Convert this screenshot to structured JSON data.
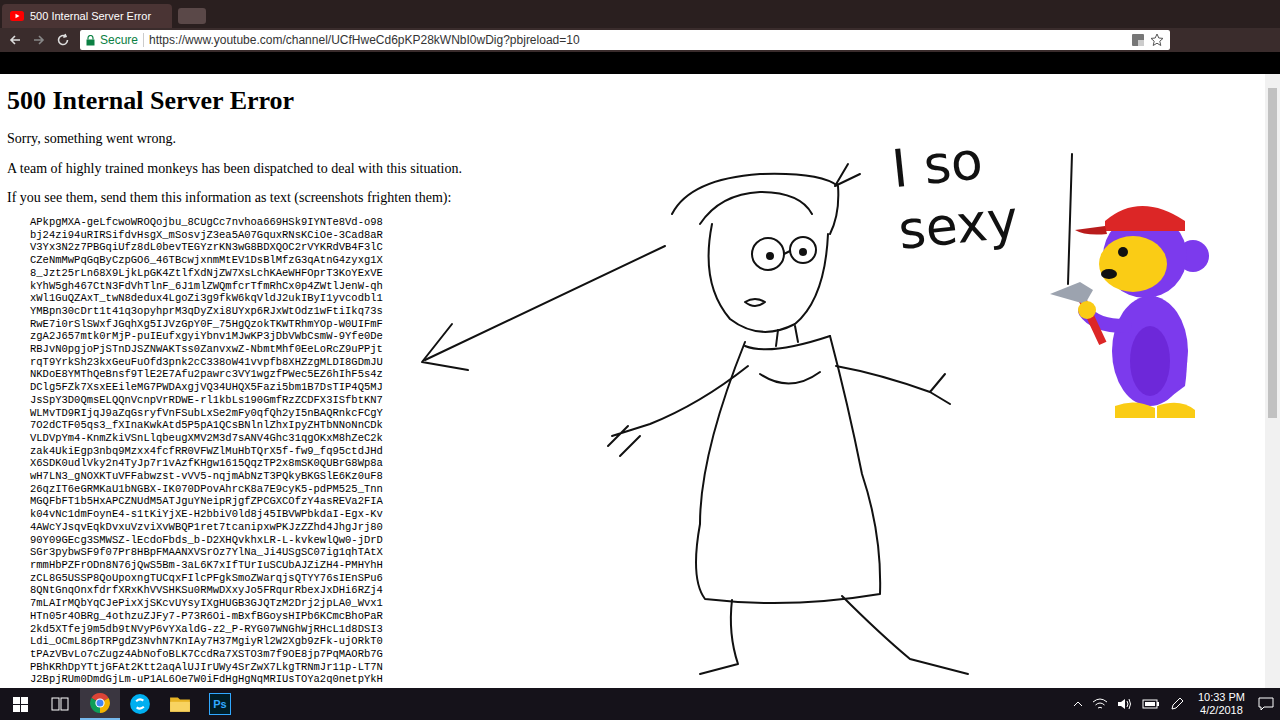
{
  "browser": {
    "tab_title": "500 Internal Server Error",
    "secure_label": "Secure",
    "url": "https://www.youtube.com/channel/UCfHweCd6pKP28kWNbI0wDig?pbjreload=10"
  },
  "page": {
    "heading": "500 Internal Server Error",
    "paragraphs": [
      "Sorry, something went wrong.",
      "A team of highly trained monkeys has been dispatched to deal with this situation.",
      "If you see them, send them this information as text (screenshots frighten them):"
    ],
    "error_lines": [
      "APkpgMXA-geLfcwoWROQojbu_8CUgCc7nvhoa669HSk9IYNTe8Vd-o98",
      "bj24zi94uRIRSifdvHsgX_mSosvjZ3ea5A07GquxRNsKCiOe-3Cad8aR",
      "V3Yx3N2z7PBGqiUfz8dL0bevTEGYzrKN3wG8BDXQOC2rVYKRdVB4F3lC",
      "CZeNmMwPqGqByCzpGO6_46TBcwjxnmMtEV1DsBlMfzG3qAtnG4zyxg1X",
      "8_Jzt25rLn68X9LjkLpGK4ZtlfXdNjZW7XsLchKAeWHFOprT3KoYExVE",
      "kYhW5gh467CtN3FdVhTlnF_6J1mlZWQmfcrTfmRhCx0p4ZWtlJenW-qh",
      "xWl1GuQZAxT_twN8dedux4LgoZi3g9fkW6kqVldJ2ukIByI1yvcodbl1",
      "YMBpn30cDrt1t41q3opyhprM3qDyZxi8UYxp6RJxWtOdz1wFtiIkq73s",
      "RwE7i0rSlSWxfJGqhXg5IJVzGpY0F_75HgQzokTKWTRhmYOp-W0UIFmF",
      "zgA2J657mtk0rMjP-puIEufxgyiYbnv1MJwKP3jDbVWbCsmW-9Yfe0De",
      "RBJvN0pgjoPjSTnDJSZNWAKTss0ZanvxwZ-NbmtMhf0EeLoRcZ9uPPjt",
      "rqT9YrkSh23kxGeuFuOfd3pnk2cC338oW41vvpfb8XHZzgMLDI8GDmJU",
      "NKDoE8YMThQeBnsf9TlE2E7Afu2pawrc3VY1wgzfPWec5EZ6hIhF5s4z",
      "DClg5FZk7XsxEEileMG7PWDAxgjVQ34UHQX5Fazi5bm1B7DsTIP4Q5MJ",
      "JsSpY3D0QmsELQQnVcnpVrRDWE-rl1kbLs190GmfRzZCDFX3ISfbtKN7",
      "WLMvTD9RIjqJ9aZqGsryfVnFSubLxSe2mFy0qfQh2yI5nBAQRnkcFCgY",
      "7O2dCTF05qs3_fXInaKwkAtd5P5pA1QCsBNlnlZhxIpyZHTbNNoNnCDk",
      "VLDVpYm4-KnmZkiVSnLlqbeugXMV2M3d7sANV4Ghc31qgOKxM8hZeC2k",
      "zak4UkiEgp3nbq9Mzxx4fcfRR0VFWZlMuHbTQrX5f-fw9_fq95ctdJHd",
      "X6SDK0udlVky2n4TyJp7r1vAzfKHgw1615QqzTP2x8mSK0QUBrG8Wp8a",
      "wH7LN3_gNOXKTuVFFabwzst-vVV5-nqjmAbNzT3PQkyBKGSlE6Kz0uF8",
      "26qzIT6eGRMKaU1bNGBX-IK070DPovAhrcK8a7E9cyK5-pdPM525_Tnn",
      "MGQFbFT1b5HxAPCZNUdM5ATJguYNeipRjgfZPCGXCOfzY4asREVa2FIA",
      "k04vNc1dmFoynE4-s1tKiYjXE-H2bbiV0ld8j45IBVWPbkdaI-Egx-Kv",
      "4AWcYJsqvEqkDvxuVzviXvWBQP1ret7tcanipxwPKJzZZhd4JhgJrj80",
      "90Y09GEcg3SMWSZ-lEcdoFbds_b-D2XHQvkhxLR-L-kvkewlQw0-jDrD",
      "SGr3pybwSF9f07Pr8HBpFMAANXVSrOz7YlNa_Ji4USgSC07ig1qhTAtX",
      "rmmHbPZFrODn8N76jQwS5Bm-3aL6K7xIfTUrIuSCUbAJZiZH4-PMHYhH",
      "zCL8G5USSP8QoUpoxngTUCqxFIlcPFgkSmoZWarqjsQTYY76sIEnSPu6",
      "8QNtGnqOnxfdrfXRxKhVVSHKSu0RMwDXxyJo5FRqurRbexJxDHi6RZj4",
      "7mLAIrMQbYqCJePixXjSKcvUYsyIXgHUGB3GJQTzM2Drj2jpLA0_Wvx1",
      "HTn05r4OBRg_4othzuZJFy7-P73R6Oi-mBxfBGoysHIPb6KCmcBhoPaR",
      "2kd5XTfej9m5db9tNVyP6vYXaldG-z2_P-RYG07WNGhWjRHcL1d8DSI3",
      "Ldi_OCmL86pTRPgdZ3NvhN7KnIAy7H37MgiyRl2W2Xgb9zFk-ujORkT0",
      "tPAzVBvLo7cZugz4AbNofoBLK7CcdRa7XSTO3m7f9OE8jp7PqMAORb7G",
      "PBhKRhDpYTtjGFAt2Ktt2aqAlUJIrUWy4SrZwX7LkgTRNmJr11p-LT7N",
      "J2BpjRUm0DmdGjLm-uP1AL6Oe7W0iFdHgHgNqMRIUsTOYa2q0netpYkH"
    ]
  },
  "doodle": {
    "caption": [
      "I so",
      "sexy"
    ]
  },
  "taskbar": {
    "apps": [
      {
        "kind": "chrome",
        "label": "",
        "selected": true
      },
      {
        "kind": "skype",
        "label": "",
        "selected": false
      },
      {
        "kind": "explorer",
        "label": "",
        "selected": false
      },
      {
        "kind": "photoshop",
        "label": "Ps",
        "selected": false
      }
    ],
    "time": "10:33 PM",
    "date": "4/2/2018"
  }
}
